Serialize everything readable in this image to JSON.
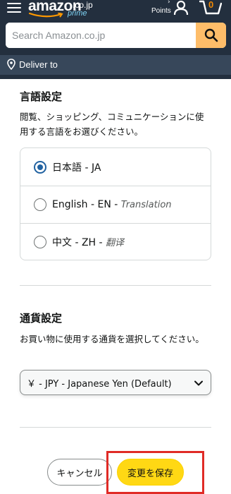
{
  "header": {
    "menu_icon": "hamburger-menu-icon",
    "logo": {
      "word": "amazon",
      "tld": ".co.jp",
      "program": "prime"
    },
    "points_label": "Points",
    "account_icon": "account-icon",
    "cart": {
      "icon": "cart-icon",
      "count": "0"
    }
  },
  "search": {
    "placeholder": "Search Amazon.co.jp",
    "value": "",
    "button_icon": "search-icon"
  },
  "deliver": {
    "icon": "location-pin-icon",
    "label": "Deliver to"
  },
  "language": {
    "title": "言語設定",
    "description": "閲覧、ショッピング、コミュニケーションに使用する言語をお選びください。",
    "options": [
      {
        "label": "日本語 - JA",
        "translation": "",
        "selected": true
      },
      {
        "label": "English - EN - ",
        "translation": "Translation",
        "selected": false
      },
      {
        "label": "中文 - ZH - ",
        "translation": "翻译",
        "selected": false
      }
    ]
  },
  "currency": {
    "title": "通貨設定",
    "description": "お買い物に使用する通貨を選択してください。",
    "selected": "￥ - JPY - Japanese Yen (Default)"
  },
  "actions": {
    "cancel_label": "キャンセル",
    "save_label": "変更を保存"
  },
  "colors": {
    "header_bg": "#232f3e",
    "subnav_bg": "#37475a",
    "search_button": "#febd69",
    "radio_selected": "#2162a1",
    "save_button": "#ffd814",
    "highlight_box": "#e02b26"
  }
}
